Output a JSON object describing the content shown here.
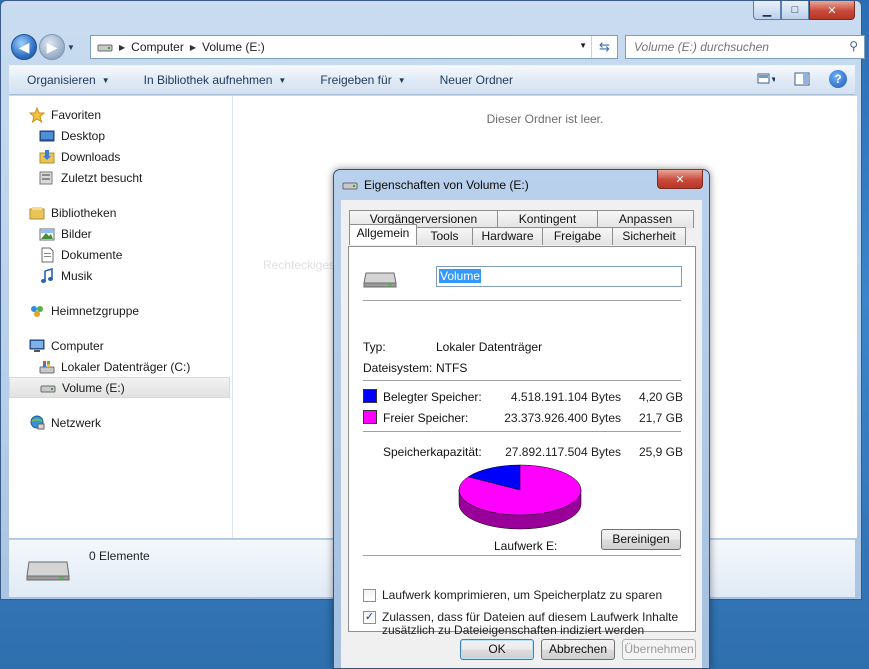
{
  "explorer": {
    "breadcrumb": [
      "Computer",
      "Volume (E:)"
    ],
    "search_placeholder": "Volume (E:) durchsuchen",
    "toolbar": {
      "organize": "Organisieren",
      "library": "In Bibliothek aufnehmen",
      "share": "Freigeben für",
      "new_folder": "Neuer Ordner"
    },
    "nav": {
      "favorites": "Favoriten",
      "desktop": "Desktop",
      "downloads": "Downloads",
      "recent": "Zuletzt besucht",
      "libraries": "Bibliotheken",
      "pictures": "Bilder",
      "documents": "Dokumente",
      "music": "Musik",
      "homegroup": "Heimnetzgruppe",
      "computer": "Computer",
      "drive_c": "Lokaler Datenträger (C:)",
      "drive_e": "Volume (E:)",
      "network": "Netzwerk"
    },
    "empty_message": "Dieser Ordner ist leer.",
    "ghost_text": "Rechteckiges Ausschneiden",
    "item_count": "0 Elemente"
  },
  "dialog": {
    "title": "Eigenschaften von Volume (E:)",
    "tabs_back": [
      "Vorgängerversionen",
      "Kontingent",
      "Anpassen"
    ],
    "tabs_front": [
      "Allgemein",
      "Tools",
      "Hardware",
      "Freigabe",
      "Sicherheit"
    ],
    "volume_name": "Volume",
    "type_label": "Typ:",
    "type_value": "Lokaler Datenträger",
    "fs_label": "Dateisystem:",
    "fs_value": "NTFS",
    "used_label": "Belegter Speicher:",
    "used_bytes": "4.518.191.104 Bytes",
    "used_gb": "4,20 GB",
    "free_label": "Freier Speicher:",
    "free_bytes": "23.373.926.400 Bytes",
    "free_gb": "21,7 GB",
    "capacity_label": "Speicherkapazität:",
    "capacity_bytes": "27.892.117.504 Bytes",
    "capacity_gb": "25,9 GB",
    "drive_label": "Laufwerk E:",
    "cleanup_button": "Bereinigen",
    "compress_label": "Laufwerk komprimieren, um Speicherplatz zu sparen",
    "compress_checked": false,
    "index_label_1": "Zulassen, dass für Dateien auf diesem Laufwerk Inhalte",
    "index_label_2": "zusätzlich zu Dateieigenschaften indiziert werden",
    "index_checked": true,
    "ok": "OK",
    "cancel": "Abbrechen",
    "apply": "Übernehmen"
  },
  "chart_data": {
    "type": "pie",
    "categories": [
      "Belegter Speicher",
      "Freier Speicher"
    ],
    "values": [
      4518191104,
      23373926400
    ],
    "colors": [
      "#0000ff",
      "#ff00ff"
    ]
  },
  "colors": {
    "used": "#0000ff",
    "free": "#ff00ff"
  }
}
